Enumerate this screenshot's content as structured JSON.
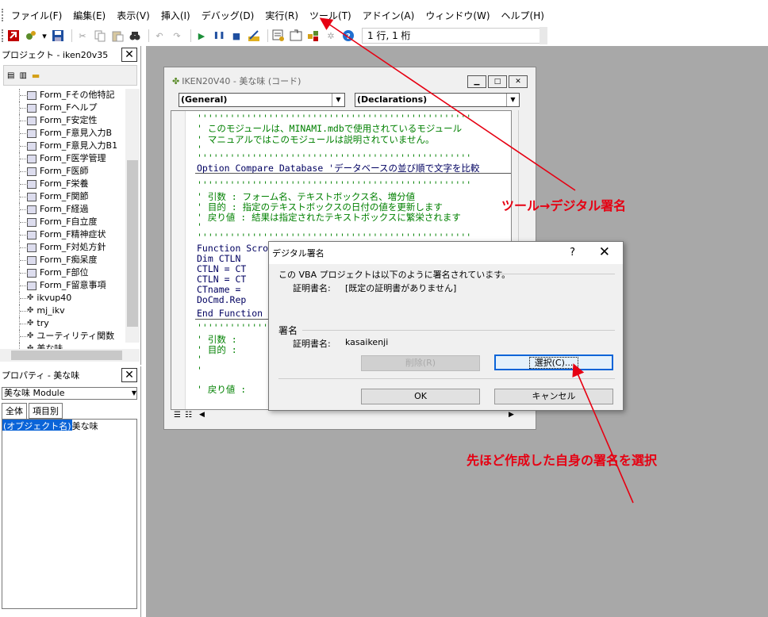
{
  "menu": [
    "ファイル(F)",
    "編集(E)",
    "表示(V)",
    "挿入(I)",
    "デバッグ(D)",
    "実行(R)",
    "ツール(T)",
    "アドイン(A)",
    "ウィンドウ(W)",
    "ヘルプ(H)"
  ],
  "toolbar": {
    "position_text": "1 行, 1 桁"
  },
  "project_pane": {
    "title": "プロジェクト - iken20v35",
    "items": [
      "Form_Fその他特記",
      "Form_Fヘルプ",
      "Form_F安定性",
      "Form_F意見入力B",
      "Form_F意見入力B1",
      "Form_F医学管理",
      "Form_F医師",
      "Form_F栄養",
      "Form_F関節",
      "Form_F経過",
      "Form_F自立度",
      "Form_F精神症状",
      "Form_F対処方針",
      "Form_F痴呆度",
      "Form_F部位",
      "Form_F留意事項",
      "ikvup40",
      "mj_ikv",
      "try",
      "ユーティリティ関数",
      "美な味"
    ]
  },
  "props_pane": {
    "title": "プロパティ - 美な味",
    "selected": "美な味 Module",
    "tab_all": "全体",
    "tab_item": "項目別",
    "row_name": "(オブジェクト名)",
    "row_value": "美な味"
  },
  "code_window": {
    "title": "IKEN20V40 - 美な味 (コード)",
    "combo_left": "(General)",
    "combo_right": "(Declarations)",
    "lines": [
      "''''''''''''''''''''''''''''''''''''''''''''''''''",
      "'    このモジュールは、MINAMI.mdbで使用されているモジュール",
      "'    マニュアルではこのモジュールは説明されていません。",
      "'",
      "''''''''''''''''''''''''''''''''''''''''''''''''''",
      "Option Compare Database   'データベースの並び順で文字を比較",
      "''''''''''''''''''''''''''''''''''''''''''''''''''",
      "' 引数     : フォーム名、テキストボックス名、増分値",
      "' 目的     : 指定のテキストボックスの日付の値を更新します",
      "' 戻り値   : 結果は指定されたテキストボックスに繁栄されます",
      "'",
      "''''''''''''''''''''''''''''''''''''''''''''''''''",
      "Function Scro",
      "    Dim CTLN",
      "    CTLN = CT",
      "    CTLN = CT",
      "    CTname =",
      "    DoCmd.Rep",
      "End Function",
      "''''''''''''''''''''''''''''''''''''''''''''''''''",
      "' 引数     :",
      "' 目的     :",
      "'",
      "'",
      "' 戻り値   :"
    ]
  },
  "dialog": {
    "title": "デジタル署名",
    "help": "?",
    "close": "✕",
    "intro": "この VBA プロジェクトは以下のように署名されています。",
    "cert_label": "証明書名:",
    "cert_value": "[既定の証明書がありません]",
    "group_label": "署名",
    "cert_label2": "証明書名:",
    "cert_value2": "kasaikenji",
    "delete_button": "削除(R)",
    "select_button": "選択(C)...",
    "ok_button": "OK",
    "cancel_button": "キャンセル"
  },
  "annotations": {
    "tool_menu": "ツール→デジタル署名",
    "select_hint": "先ほど作成した自身の署名を選択",
    "color": "#e60012"
  }
}
